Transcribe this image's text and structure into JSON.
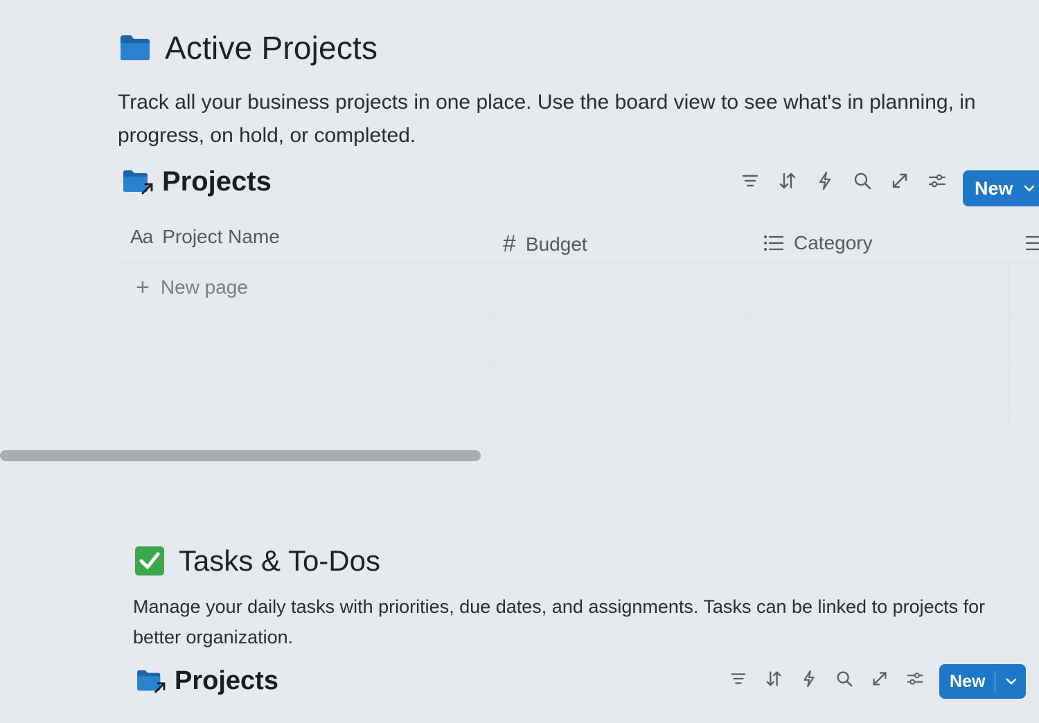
{
  "page": {
    "title": "Active Projects",
    "icon": "folder-icon",
    "description": "Track all your business projects in one place. Use the board view to see what's in planning, in progress, on hold, or completed."
  },
  "projects_db": {
    "title": "Projects",
    "icon": "linked-folder-icon",
    "toolbar": {
      "icons": [
        "filter-icon",
        "sort-icon",
        "automation-icon",
        "search-icon",
        "expand-icon",
        "settings-icon"
      ],
      "new_label": "New"
    },
    "columns": [
      {
        "icon": "Aa",
        "label": "Project Name"
      },
      {
        "icon": "#",
        "label": "Budget"
      },
      {
        "icon": "list-icon",
        "label": "Category"
      }
    ],
    "new_page_label": "New page"
  },
  "tasks_section": {
    "title": "Tasks & To-Dos",
    "icon": "check-mark-icon",
    "description": "Manage your daily tasks with priorities, due dates, and assignments. Tasks can be linked to projects for better organization."
  },
  "tasks_db": {
    "title": "Projects",
    "icon": "linked-folder-icon",
    "new_label": "New"
  },
  "colors": {
    "accent": "#1f77c8",
    "folder": "#1e6fb5",
    "check": "#3aa84a"
  }
}
